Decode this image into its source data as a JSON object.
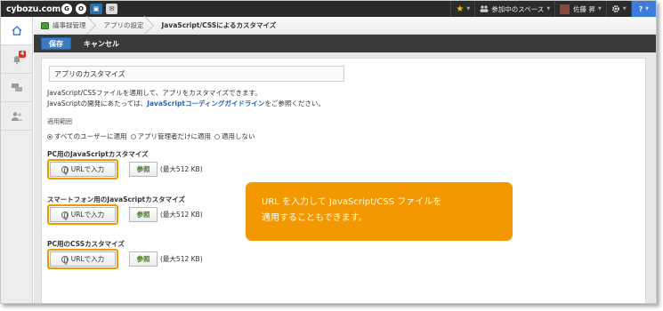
{
  "topbar": {
    "logo": "cybozu.com",
    "apps": [
      "G",
      "O",
      "▣",
      "✉"
    ],
    "spaces_label": "参加中のスペース",
    "user_name": "佐藤 昇",
    "help_label": "?",
    "star_symbol": "★",
    "caret": "▼"
  },
  "leftnav": {
    "notification_count": "4",
    "icons": [
      "home-icon",
      "bell-icon",
      "people-chat-icon",
      "user-group-icon"
    ]
  },
  "breadcrumb": {
    "items": [
      "議事録管理",
      "アプリの設定",
      "JavaScript/CSSによるカスタマイズ"
    ]
  },
  "actionbar": {
    "save_label": "保存",
    "cancel_label": "キャンセル"
  },
  "main": {
    "section_title": "アプリのカスタマイズ",
    "desc_line1": "JavaScript/CSSファイルを適用して、アプリをカスタマイズできます。",
    "desc_line2_pre": "JavaScriptの開発にあたっては、",
    "desc_line2_link": "JavaScriptコーディングガイドライン",
    "desc_line2_post": "をご参照ください。",
    "scope_label": "適用範囲",
    "scope_options": [
      "すべてのユーザーに適用",
      "アプリ管理者だけに適用",
      "適用しない"
    ],
    "scope_selected": 0,
    "sections": [
      {
        "title": "PC用のJavaScriptカスタマイズ",
        "url_button": "URLで入力",
        "ref_button": "参照",
        "max_size": "(最大512 KB)"
      },
      {
        "title": "スマートフォン用のJavaScriptカスタマイズ",
        "url_button": "URLで入力",
        "ref_button": "参照",
        "max_size": "(最大512 KB)"
      },
      {
        "title": "PC用のCSSカスタマイズ",
        "url_button": "URLで入力",
        "ref_button": "参照",
        "max_size": "(最大512 KB)"
      }
    ]
  },
  "callout": {
    "line1": "URL を入力して JavaScript/CSS ファイルを",
    "line2": "適用することもできます。"
  },
  "colors": {
    "highlight": "#f39800",
    "primary": "#3a7bc8",
    "link": "#2a63b5",
    "badge": "#d93025"
  }
}
